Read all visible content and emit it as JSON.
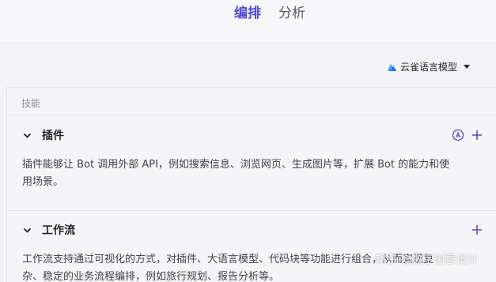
{
  "header": {
    "tabs": [
      {
        "label": "编排",
        "active": true
      },
      {
        "label": "分析",
        "active": false
      }
    ]
  },
  "model": {
    "name": "云雀语言模型",
    "icon": "mountain-logo-icon",
    "accent": "#1e6bff"
  },
  "skills": {
    "section_label": "技能",
    "blocks": [
      {
        "title": "插件",
        "description_line1": "插件能够让 Bot 调用外部 API，例如搜索信息、浏览网页、生成图片等，扩展 Bot 的能力和使",
        "description_line2": "用场景。",
        "icons": [
          "auto-circle-icon",
          "plus-icon"
        ]
      },
      {
        "title": "工作流",
        "description_line1": "工作流支持通过可视化的方式，对插件、大语言模型、代码块等功能进行组合，从而实现复",
        "description_line2": "杂、稳定的业务流程编排，例如旅行规划、报告分析等。",
        "icons": [
          "plus-icon"
        ]
      }
    ]
  },
  "watermark": "知乎 @数字创意设计",
  "colors": {
    "accent": "#4e49d8",
    "background": "#f3f3f7"
  }
}
